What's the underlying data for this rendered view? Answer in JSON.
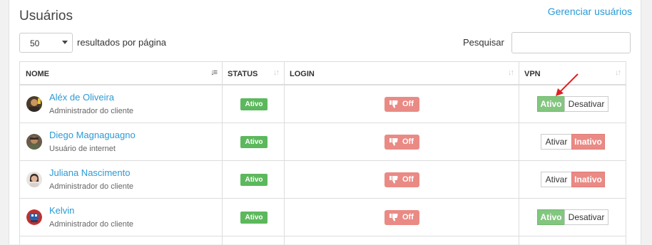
{
  "header": {
    "title": "Usuários",
    "manage_link": "Gerenciar usuários"
  },
  "controls": {
    "page_size": "50",
    "per_page_label": "resultados por página",
    "search_label": "Pesquisar",
    "search_value": ""
  },
  "table": {
    "columns": [
      {
        "label": "NOME",
        "sort": "active"
      },
      {
        "label": "STATUS",
        "sort": "inactive"
      },
      {
        "label": "LOGIN",
        "sort": "inactive"
      },
      {
        "label": "VPN",
        "sort": "inactive"
      }
    ],
    "rows": [
      {
        "name": "Aléx de Oliveira",
        "role": "Administrador do cliente",
        "status": "Ativo",
        "login": "Off",
        "vpn_state": "on",
        "vpn_on_label": "Ativo",
        "vpn_off_label": "Desativar"
      },
      {
        "name": "Diego Magnaguagno",
        "role": "Usuário de internet",
        "status": "Ativo",
        "login": "Off",
        "vpn_state": "off",
        "vpn_on_label": "Ativar",
        "vpn_off_label": "Inativo"
      },
      {
        "name": "Juliana Nascimento",
        "role": "Administrador do cliente",
        "status": "Ativo",
        "login": "Off",
        "vpn_state": "off",
        "vpn_on_label": "Ativar",
        "vpn_off_label": "Inativo"
      },
      {
        "name": "Kelvin",
        "role": "Administrador do cliente",
        "status": "Ativo",
        "login": "Off",
        "vpn_state": "on",
        "vpn_on_label": "Ativo",
        "vpn_off_label": "Desativar"
      }
    ]
  },
  "colors": {
    "link": "#2a9ad6",
    "success": "#5cb85c",
    "danger_light": "#ea8a85",
    "annotation": "#e02020"
  }
}
